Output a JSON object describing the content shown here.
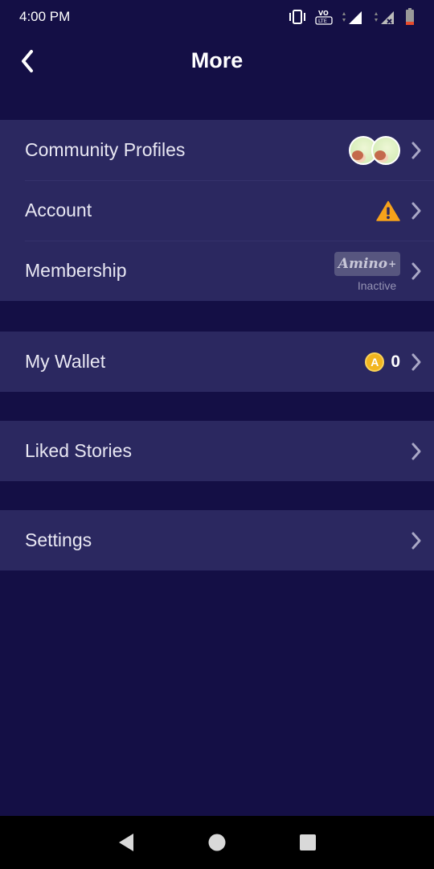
{
  "status_bar": {
    "time": "4:00 PM",
    "icons": [
      "vibrate-icon",
      "volte-icon",
      "signal-icon",
      "signal-no-service-icon",
      "battery-low-icon"
    ]
  },
  "header": {
    "title": "More",
    "back_icon": "back-chevron-icon"
  },
  "colors": {
    "background": "#140f45",
    "row_background": "#2b2860",
    "warning": "#f7a21b",
    "coin": "#f2b51f",
    "badge_background": "#57567f"
  },
  "sections": {
    "profile": {
      "community_profiles": {
        "label": "Community Profiles"
      },
      "account": {
        "label": "Account",
        "icon": "warning-icon"
      },
      "membership": {
        "label": "Membership",
        "badge": "Amino",
        "badge_plus": "+",
        "status": "Inactive"
      }
    },
    "wallet": {
      "label": "My Wallet",
      "coin_symbol": "A",
      "value": "0"
    },
    "liked_stories": {
      "label": "Liked Stories"
    },
    "settings": {
      "label": "Settings"
    }
  },
  "nav_bar": {
    "icons": [
      "nav-back-icon",
      "nav-home-icon",
      "nav-recents-icon"
    ]
  }
}
